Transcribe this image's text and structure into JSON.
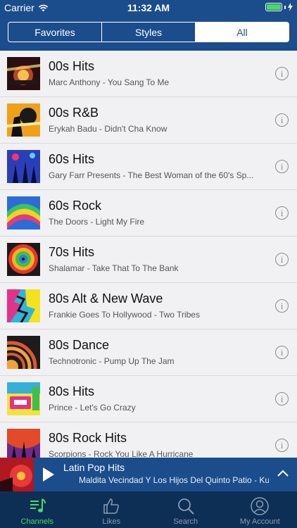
{
  "status_bar": {
    "carrier": "Carrier",
    "time": "11:32 AM"
  },
  "segmented_control": {
    "tabs": [
      {
        "label": "Favorites",
        "selected": false
      },
      {
        "label": "Styles",
        "selected": false
      },
      {
        "label": "All",
        "selected": true
      }
    ]
  },
  "channels": [
    {
      "title": "00s Hits",
      "subtitle": "Marc Anthony - You Sang To Me"
    },
    {
      "title": "00s R&B",
      "subtitle": "Erykah Badu - Didn't Cha Know"
    },
    {
      "title": "60s Hits",
      "subtitle": "Gary Farr Presents - The Best Woman of the 60's Sp..."
    },
    {
      "title": "60s Rock",
      "subtitle": "The Doors - Light My Fire"
    },
    {
      "title": "70s Hits",
      "subtitle": "Shalamar - Take That To The Bank"
    },
    {
      "title": "80s Alt & New Wave",
      "subtitle": "Frankie Goes To Hollywood - Two Tribes"
    },
    {
      "title": "80s Dance",
      "subtitle": "Technotronic - Pump Up The Jam"
    },
    {
      "title": "80s Hits",
      "subtitle": "Prince - Let's Go Crazy"
    },
    {
      "title": "80s Rock Hits",
      "subtitle": "Scorpions - Rock You Like A Hurricane"
    }
  ],
  "now_playing": {
    "channel": "Latin Pop Hits",
    "track": "Maldita Vecindad Y Los Hijos Del Quinto Patio - Kumbala"
  },
  "tab_bar": {
    "tabs": [
      {
        "label": "Channels",
        "icon": "music-note-icon",
        "active": true
      },
      {
        "label": "Likes",
        "icon": "thumbs-up-icon",
        "active": false
      },
      {
        "label": "Search",
        "icon": "search-icon",
        "active": false
      },
      {
        "label": "My Account",
        "icon": "user-icon",
        "active": false
      }
    ]
  },
  "colors": {
    "header": "#1b4d8c",
    "tab_bar": "#0d2f56",
    "active_tab": "#4cd964",
    "list_background": "#f1f1f3"
  }
}
